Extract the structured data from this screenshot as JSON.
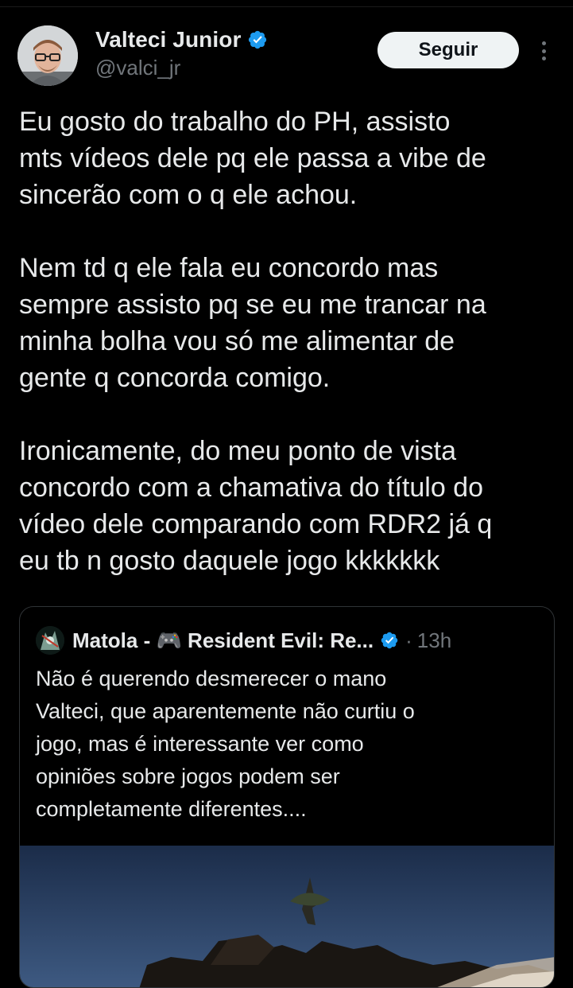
{
  "tweet": {
    "author": {
      "name": "Valteci Junior",
      "handle": "@valci_jr",
      "verified": true
    },
    "follow_label": "Seguir",
    "more_icon": "more-vertical-icon",
    "text_lines": [
      "Eu gosto do trabalho do PH, assisto",
      "mts vídeos dele pq ele passa a vibe de",
      "sincerão com o q ele achou.",
      "",
      "Nem td q ele fala eu concordo mas",
      "sempre assisto pq se eu me trancar na",
      "minha bolha vou só me alimentar de",
      "gente q concorda comigo.",
      "",
      "Ironicamente, do meu ponto de vista",
      "concordo com a chamativa do título do",
      "vídeo dele comparando com RDR2 já q",
      "eu tb n gosto daquele jogo kkkkkkk"
    ]
  },
  "quote": {
    "author_name": "Matola - 🎮 Resident Evil: Re...",
    "verified": true,
    "separator": "·",
    "time": "13h",
    "text_lines": [
      "Não é querendo desmerecer o mano",
      "Valteci, que aparentemente não curtiu o",
      "jogo, mas é interessante ver como",
      "opiniões sobre jogos podem ser",
      "completamente diferentes...."
    ]
  },
  "colors": {
    "background": "#000000",
    "text_primary": "#e7e9ea",
    "text_secondary": "#71767b",
    "verified_blue": "#1d9bf0",
    "follow_button_bg": "#eff3f4",
    "card_border": "#2f3336"
  }
}
